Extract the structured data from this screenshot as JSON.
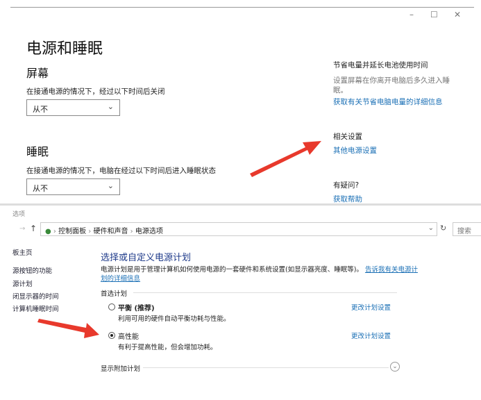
{
  "settings": {
    "title": "电源和睡眠",
    "window_controls": {
      "minimize": "–",
      "maximize": "☐",
      "close": "✕"
    },
    "screen": {
      "heading": "屏幕",
      "label": "在接通电源的情况下，经过以下时间后关闭",
      "value": "从不"
    },
    "sleep": {
      "heading": "睡眠",
      "label": "在接通电源的情况下，电脑在经过以下时间后进入睡眠状态",
      "value": "从不"
    },
    "side": {
      "save_heading": "节省电量并延长电池使用时间",
      "save_desc_1": "设置屏幕在你离开电脑后多久进入睡",
      "save_desc_2": "眠。",
      "save_link": "获取有关节省电脑电量的详细信息",
      "related_heading": "相关设置",
      "related_link": "其他电源设置",
      "help_heading": "有疑问?",
      "help_link": "获取帮助"
    }
  },
  "control_panel": {
    "window_title": "选项",
    "breadcrumb": [
      "控制面板",
      "硬件和声音",
      "电源选项"
    ],
    "search_placeholder": "搜索",
    "sidebar": [
      "板主页",
      "源按钮的功能",
      "源计划",
      "闭显示器的时间",
      "计算机睡眠时间"
    ],
    "heading": "选择或自定义电源计划",
    "desc": "电源计划是用于管理计算机如何使用电源的一套硬件和系统设置(如显示器亮度、睡眠等)。",
    "desc_link_1": "告诉我有关电源计",
    "desc_link_2": "划的详细信息",
    "preferred_label": "首选计划",
    "plans": [
      {
        "name": "平衡 (推荐)",
        "desc": "利用可用的硬件自动平衡功耗与性能。",
        "selected": false,
        "change_link": "更改计划设置"
      },
      {
        "name": "高性能",
        "desc": "有利于提高性能，但会增加功耗。",
        "selected": true,
        "change_link": "更改计划设置"
      }
    ],
    "show_more": "显示附加计划"
  },
  "colors": {
    "arrow": "#e8392c",
    "link": "#1a6fb5",
    "heading": "#1e3a8a"
  }
}
